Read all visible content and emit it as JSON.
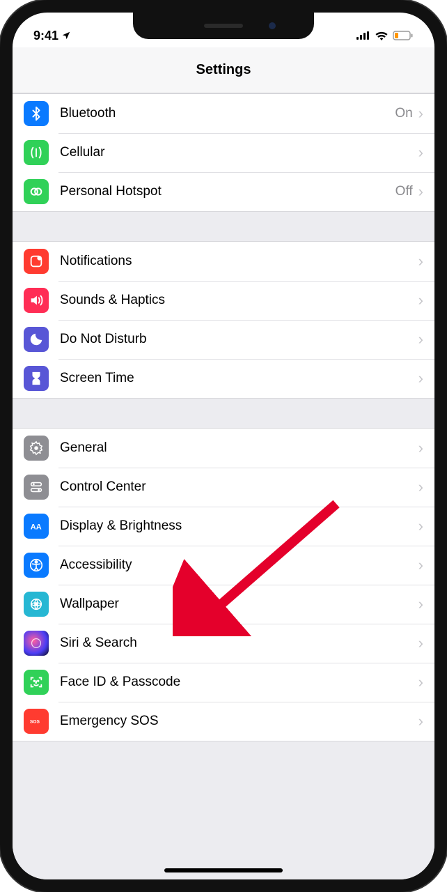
{
  "statusbar": {
    "time": "9:41",
    "location_icon": "location"
  },
  "header": {
    "title": "Settings"
  },
  "groups": [
    {
      "rows": [
        {
          "icon": "bluetooth",
          "bg": "#0A7AFF",
          "label": "Bluetooth",
          "value": "On"
        },
        {
          "icon": "cellular",
          "bg": "#30D158",
          "label": "Cellular",
          "value": ""
        },
        {
          "icon": "hotspot",
          "bg": "#30D158",
          "label": "Personal Hotspot",
          "value": "Off"
        }
      ]
    },
    {
      "rows": [
        {
          "icon": "notifications",
          "bg": "#FF3B30",
          "label": "Notifications",
          "value": ""
        },
        {
          "icon": "sounds",
          "bg": "#FF2D55",
          "label": "Sounds & Haptics",
          "value": ""
        },
        {
          "icon": "dnd",
          "bg": "#5856D6",
          "label": "Do Not Disturb",
          "value": ""
        },
        {
          "icon": "screentime",
          "bg": "#5856D6",
          "label": "Screen Time",
          "value": ""
        }
      ]
    },
    {
      "rows": [
        {
          "icon": "general",
          "bg": "#8E8E93",
          "label": "General",
          "value": ""
        },
        {
          "icon": "controlcenter",
          "bg": "#8E8E93",
          "label": "Control Center",
          "value": ""
        },
        {
          "icon": "display",
          "bg": "#0A7AFF",
          "label": "Display & Brightness",
          "value": ""
        },
        {
          "icon": "accessibility",
          "bg": "#0A7AFF",
          "label": "Accessibility",
          "value": ""
        },
        {
          "icon": "wallpaper",
          "bg": "#26B7D3",
          "label": "Wallpaper",
          "value": ""
        },
        {
          "icon": "siri",
          "bg": "#1B1B2E",
          "label": "Siri & Search",
          "value": ""
        },
        {
          "icon": "faceid",
          "bg": "#30D158",
          "label": "Face ID & Passcode",
          "value": ""
        },
        {
          "icon": "sos",
          "bg": "#FF3B30",
          "label": "Emergency SOS",
          "value": ""
        }
      ]
    }
  ]
}
